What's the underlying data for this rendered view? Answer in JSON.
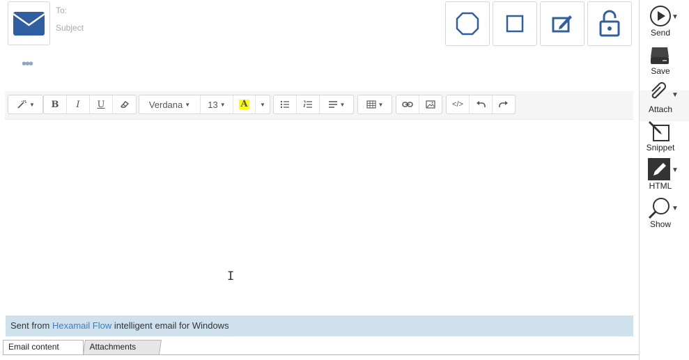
{
  "compose": {
    "to_label": "To:",
    "subject_label": "Subject",
    "more_label": "•••"
  },
  "toolbar": {
    "font_name": "Verdana",
    "font_size": "13",
    "bold": "B",
    "italic": "I",
    "underline": "U",
    "highlight_letter": "A",
    "code_label": "</>"
  },
  "editor": {
    "signature_prefix": "Sent from ",
    "signature_link": "Hexamail Flow",
    "signature_suffix": " intelligent email for Windows"
  },
  "tabs": {
    "email_content": "Email content",
    "attachments": "Attachments"
  },
  "sidebar": {
    "send": "Send",
    "save": "Save",
    "attach": "Attach",
    "snippet": "Snippet",
    "html": "HTML",
    "show": "Show"
  },
  "colors": {
    "accent": "#2f5fa1",
    "signature_bg": "#d0e1ee",
    "link": "#3a7dc7",
    "highlight": "#ffff00"
  }
}
